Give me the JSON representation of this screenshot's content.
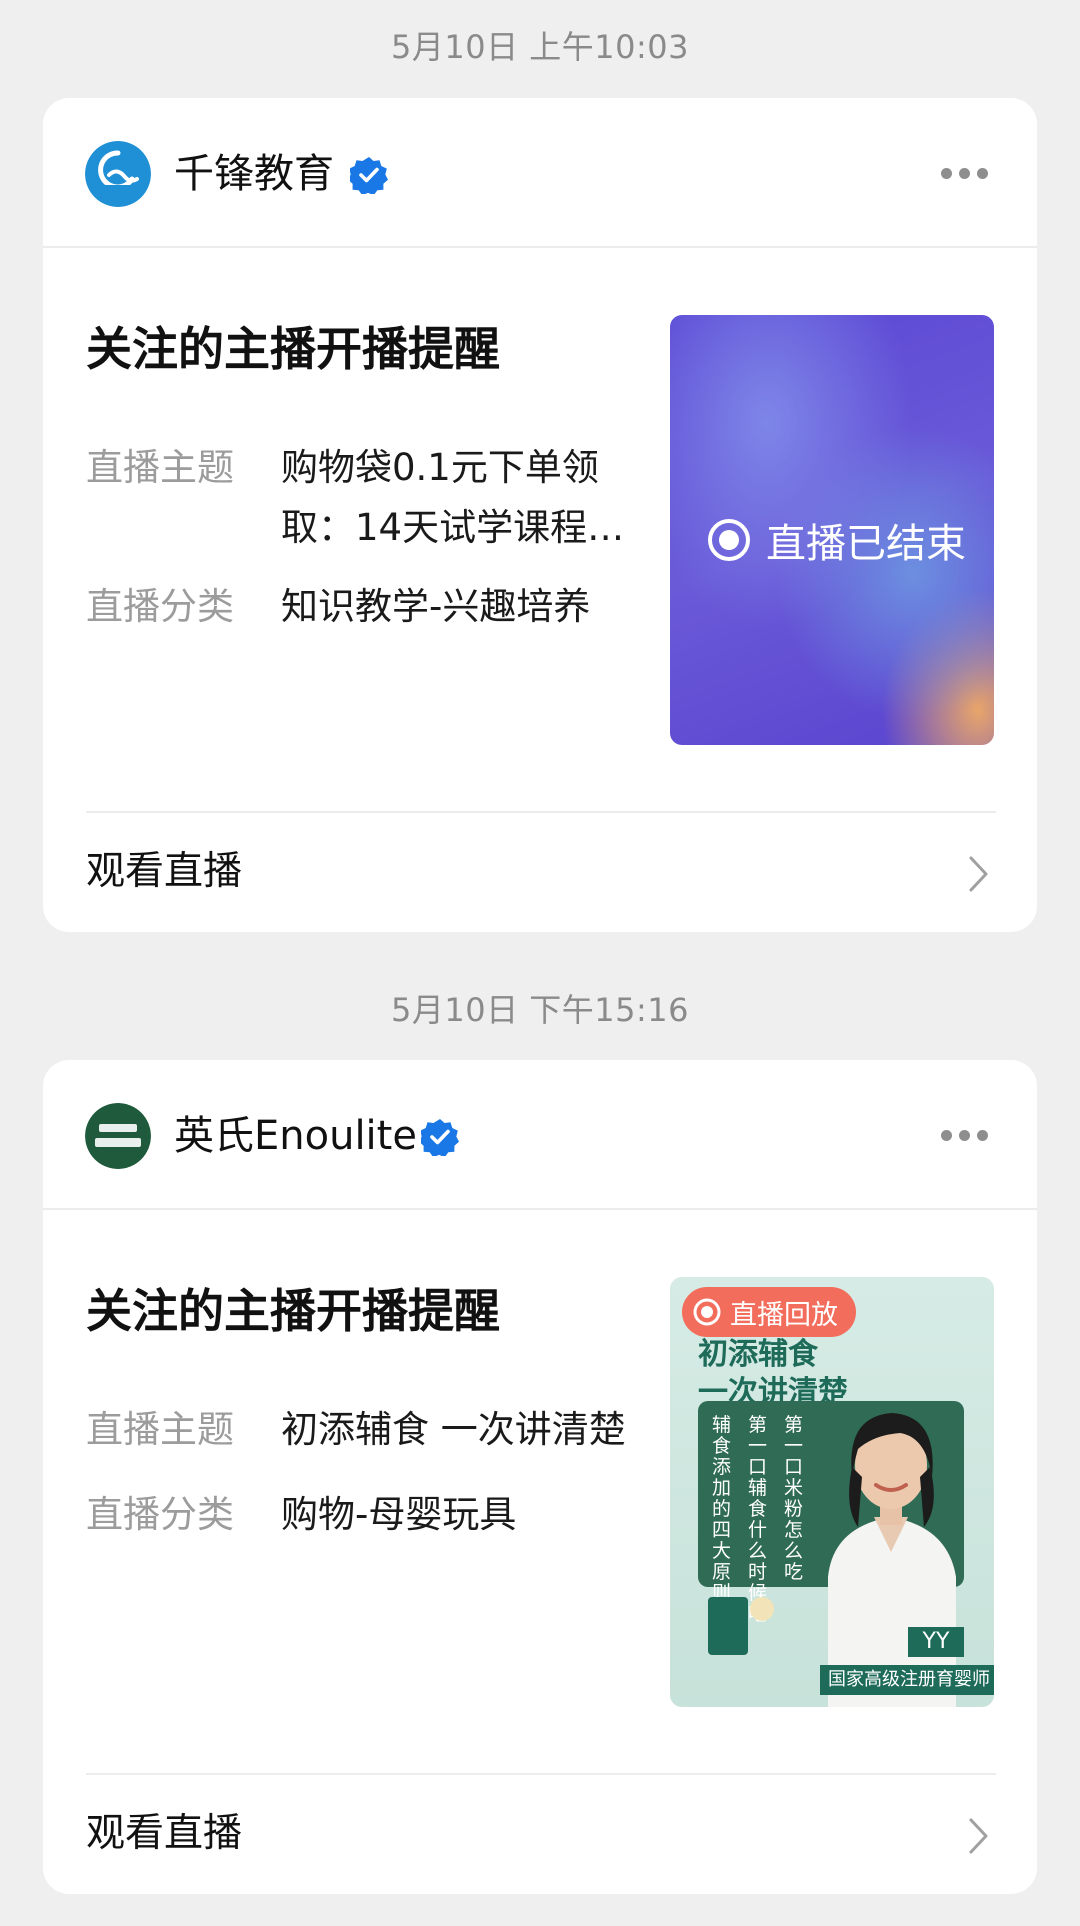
{
  "cards": [
    {
      "timestamp": "5月10日 上午10:03",
      "account_name": "千锋教育",
      "avatar_text": "千锋教育",
      "title": "关注的主播开播提醒",
      "topic_label": "直播主题",
      "topic_line1": "购物袋0.1元下单领",
      "topic_line2": "取：14天试学课程…",
      "category_label": "直播分类",
      "category_value": "知识教学-兴趣培养",
      "thumbnail_status": "直播已结束",
      "action_label": "观看直播",
      "colors": {
        "avatar": "#1f8fd6",
        "thumb_from": "#5a4fd6",
        "thumb_to": "#7b74e0"
      }
    },
    {
      "timestamp": "5月10日 下午15:16",
      "account_name": "英氏Enoulite",
      "avatar_text": "英氏 Enoulite",
      "title": "关注的主播开播提醒",
      "topic_label": "直播主题",
      "topic_value": "初添辅食 一次讲清楚",
      "category_label": "直播分类",
      "category_value": "购物-母婴玩具",
      "thumbnail_badge": "直播回放",
      "thumbnail_heading1": "初添辅食",
      "thumbnail_heading2": "一次讲清楚",
      "thumbnail_col1": "辅食添加的四大原则",
      "thumbnail_col2": "第一口辅食什么时候吃",
      "thumbnail_col3": "第一口米粉怎么吃",
      "thumbnail_caption": "国家高级注册育婴师",
      "thumbnail_tag": "YY",
      "action_label": "观看直播",
      "colors": {
        "avatar": "#1f5a3c",
        "badge": "#f26d5b",
        "thumb_bg": "#cfe6e0",
        "panel": "#2f6b55"
      }
    }
  ],
  "icons": [
    "verified-badge-icon",
    "more-dots-icon",
    "chevron-right-icon",
    "live-ended-icon",
    "replay-icon"
  ]
}
